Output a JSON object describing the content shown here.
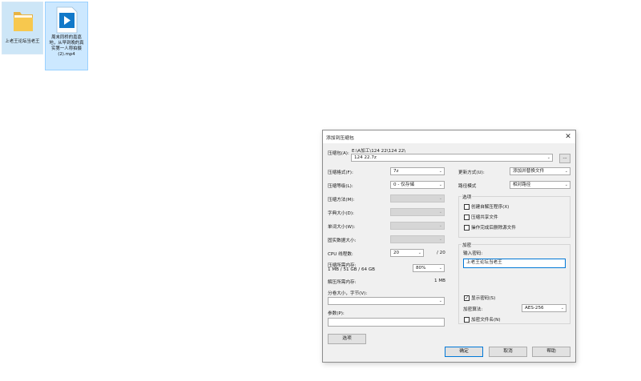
{
  "desktop": {
    "folder_label": "上老王论坛当老王",
    "video_label": "周末同桥的嘉嘉地，从早到晚的真实第一人称拍摄 (2).mp4"
  },
  "dialog": {
    "title": "添加到压缩包",
    "archive_label": "压缩包(A):",
    "archive_path": "E:\\A加工\\124 22\\124 22\\",
    "archive_name": "124 22.7z",
    "browse_label": "...",
    "left": {
      "format_label": "压缩格式(F):",
      "format_value": "7z",
      "level_label": "压缩等级(L):",
      "level_value": "0 - 仅存储",
      "method_label": "压缩方法(M):",
      "dict_label": "字典大小(D):",
      "word_label": "单词大小(W):",
      "solid_label": "固实数据大小:",
      "cpu_label": "CPU 线程数:",
      "cpu_value": "20",
      "cpu_max": "/ 20",
      "mem_label": "压缩所需内存:",
      "mem_detail": "1 MB / 51 GB / 64 GB",
      "mem_percent": "80%",
      "decomp_label": "解压所需内存:",
      "decomp_value": "1 MB",
      "split_label": "分卷大小，字节(V):",
      "params_label": "参数(P):",
      "options_button": "选项"
    },
    "right": {
      "update_label": "更新方式(U):",
      "update_value": "添加并替换文件",
      "pathmode_label": "路径模式",
      "pathmode_value": "相对路径",
      "options_group": "选项",
      "opt_sfx": "创建自解压程序(X)",
      "opt_shared": "压缩共享文件",
      "opt_delete": "操作完成后删除源文件",
      "encrypt_group": "加密",
      "password_label": "输入密码:",
      "password_value": "上老王论坛当老王",
      "show_password": "显示密码(S)",
      "enc_method_label": "加密算法:",
      "enc_method_value": "AES-256",
      "encrypt_names": "加密文件名(N)"
    },
    "buttons": {
      "ok": "确定",
      "cancel": "取消",
      "help": "帮助"
    }
  }
}
